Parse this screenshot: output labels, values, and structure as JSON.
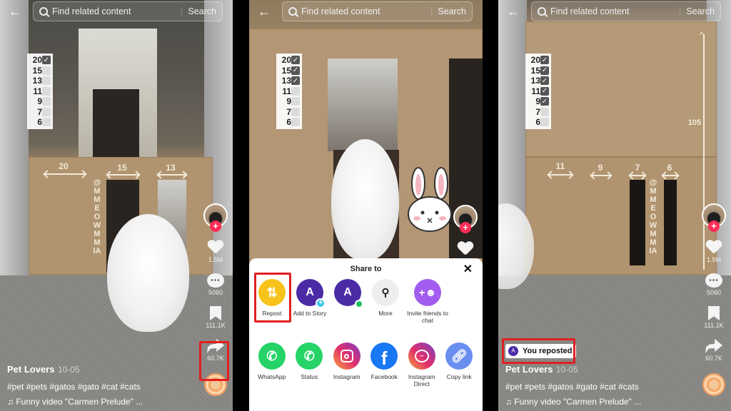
{
  "search": {
    "placeholder": "Find related content",
    "button": "Search",
    "back_icon": "arrow-left-icon"
  },
  "panels": [
    {
      "checklist": [
        {
          "num": "20",
          "checked": true
        },
        {
          "num": "15",
          "checked": false
        },
        {
          "num": "13",
          "checked": false
        },
        {
          "num": "11",
          "checked": false
        },
        {
          "num": "9",
          "checked": false
        },
        {
          "num": "7",
          "checked": false
        },
        {
          "num": "6",
          "checked": false
        }
      ],
      "scene_labels": [
        "20",
        "15",
        "13"
      ],
      "watermark": "@MMEOWMMIA",
      "rail": {
        "likes": "1.5M",
        "comments": "5060",
        "saves": "111.1K",
        "shares": "60.7K"
      },
      "highlighted": "share-button",
      "caption": {
        "user": "Pet Lovers",
        "date": "10-05",
        "tags": "#pet #pets #gatos #gato #cat #cats",
        "music": "Funny video \"Carmen Prelude\" ..."
      }
    },
    {
      "checklist": [
        {
          "num": "20",
          "checked": true
        },
        {
          "num": "15",
          "checked": true
        },
        {
          "num": "13",
          "checked": true
        },
        {
          "num": "11",
          "checked": false
        },
        {
          "num": "9",
          "checked": false
        },
        {
          "num": "7",
          "checked": false
        },
        {
          "num": "6",
          "checked": false
        }
      ],
      "share_sheet": {
        "title": "Share to",
        "close_icon": "close-icon",
        "row1": [
          {
            "label": "Repost",
            "icon": "repost-icon",
            "color": "#f7c31b",
            "highlighted": true
          },
          {
            "label": "Add to Story",
            "icon": "avatar-add-icon",
            "color": "#4b2aa6",
            "letter": "A"
          },
          {
            "label": "",
            "icon": "avatar-online-icon",
            "color": "#4b2aa6",
            "letter": "A"
          },
          {
            "label": "More",
            "icon": "search-icon",
            "color": "#eeeeee"
          },
          {
            "label": "Invite friends to chat",
            "icon": "add-friend-icon",
            "color": "#a35cf0"
          }
        ],
        "row2": [
          {
            "label": "WhatsApp",
            "icon": "whatsapp-icon",
            "color": "#25d366"
          },
          {
            "label": "Status",
            "icon": "whatsapp-status-icon",
            "color": "#25d366"
          },
          {
            "label": "Instagram",
            "icon": "instagram-icon",
            "color": "#e1306c"
          },
          {
            "label": "Facebook",
            "icon": "facebook-icon",
            "color": "#1877f2"
          },
          {
            "label": "Instagram Direct",
            "icon": "messenger-icon",
            "color": "#c13584"
          },
          {
            "label": "Copy link",
            "icon": "link-icon",
            "color": "#6a8ef0"
          }
        ]
      }
    },
    {
      "checklist": [
        {
          "num": "20",
          "checked": true
        },
        {
          "num": "15",
          "checked": true
        },
        {
          "num": "13",
          "checked": true
        },
        {
          "num": "11",
          "checked": true
        },
        {
          "num": "9",
          "checked": true
        },
        {
          "num": "7",
          "checked": false
        },
        {
          "num": "6",
          "checked": false
        }
      ],
      "scene_labels": [
        "11",
        "9",
        "7",
        "6"
      ],
      "height_label": "105",
      "watermark": "@MMEOWMMIA",
      "rail": {
        "likes": "1.5M",
        "comments": "5060",
        "saves": "111.1K",
        "shares": "60.7K"
      },
      "reposted_badge": {
        "avatar": "A",
        "text": "You reposted"
      },
      "caption": {
        "user": "Pet Lovers",
        "date": "10-05",
        "tags": "#pet #pets #gatos #gato #cat #cats",
        "music": "Funny video \"Carmen Prelude\" ..."
      }
    }
  ],
  "colors": {
    "accent_red": "#fe2c55",
    "highlight_box": "#e02020",
    "repost_yellow": "#f7c31b"
  }
}
